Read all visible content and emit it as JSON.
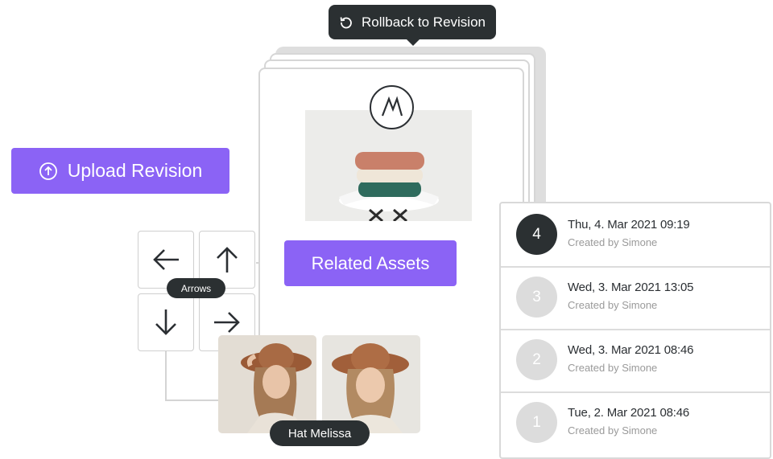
{
  "tooltip": {
    "label": "Rollback to Revision",
    "icon": "rollback-icon"
  },
  "upload_button": {
    "label": "Upload Revision",
    "icon": "upload-circle-icon"
  },
  "related_button": {
    "label": "Related Assets"
  },
  "logo": {
    "icon": "brand-logo-m"
  },
  "arrows": {
    "pill_label": "Arrows",
    "tiles": [
      {
        "icon": "arrow-left-icon"
      },
      {
        "icon": "arrow-up-icon"
      },
      {
        "icon": "arrow-down-icon"
      },
      {
        "icon": "arrow-right-icon"
      }
    ]
  },
  "portrait_group": {
    "pill_label": "Hat Melissa"
  },
  "revisions": [
    {
      "number": "4",
      "date": "Thu, 4. Mar 2021 09:19",
      "author": "Created by Simone",
      "active": true
    },
    {
      "number": "3",
      "date": "Wed, 3. Mar 2021 13:05",
      "author": "Created by Simone",
      "active": false
    },
    {
      "number": "2",
      "date": "Wed, 3. Mar 2021 08:46",
      "author": "Created by Simone",
      "active": false
    },
    {
      "number": "1",
      "date": "Tue, 2. Mar 2021 08:46",
      "author": "Created by Simone",
      "active": false
    }
  ],
  "colors": {
    "accent": "#8b63f5",
    "dark": "#2b3032",
    "inactive_badge": "#dcdcdc"
  }
}
